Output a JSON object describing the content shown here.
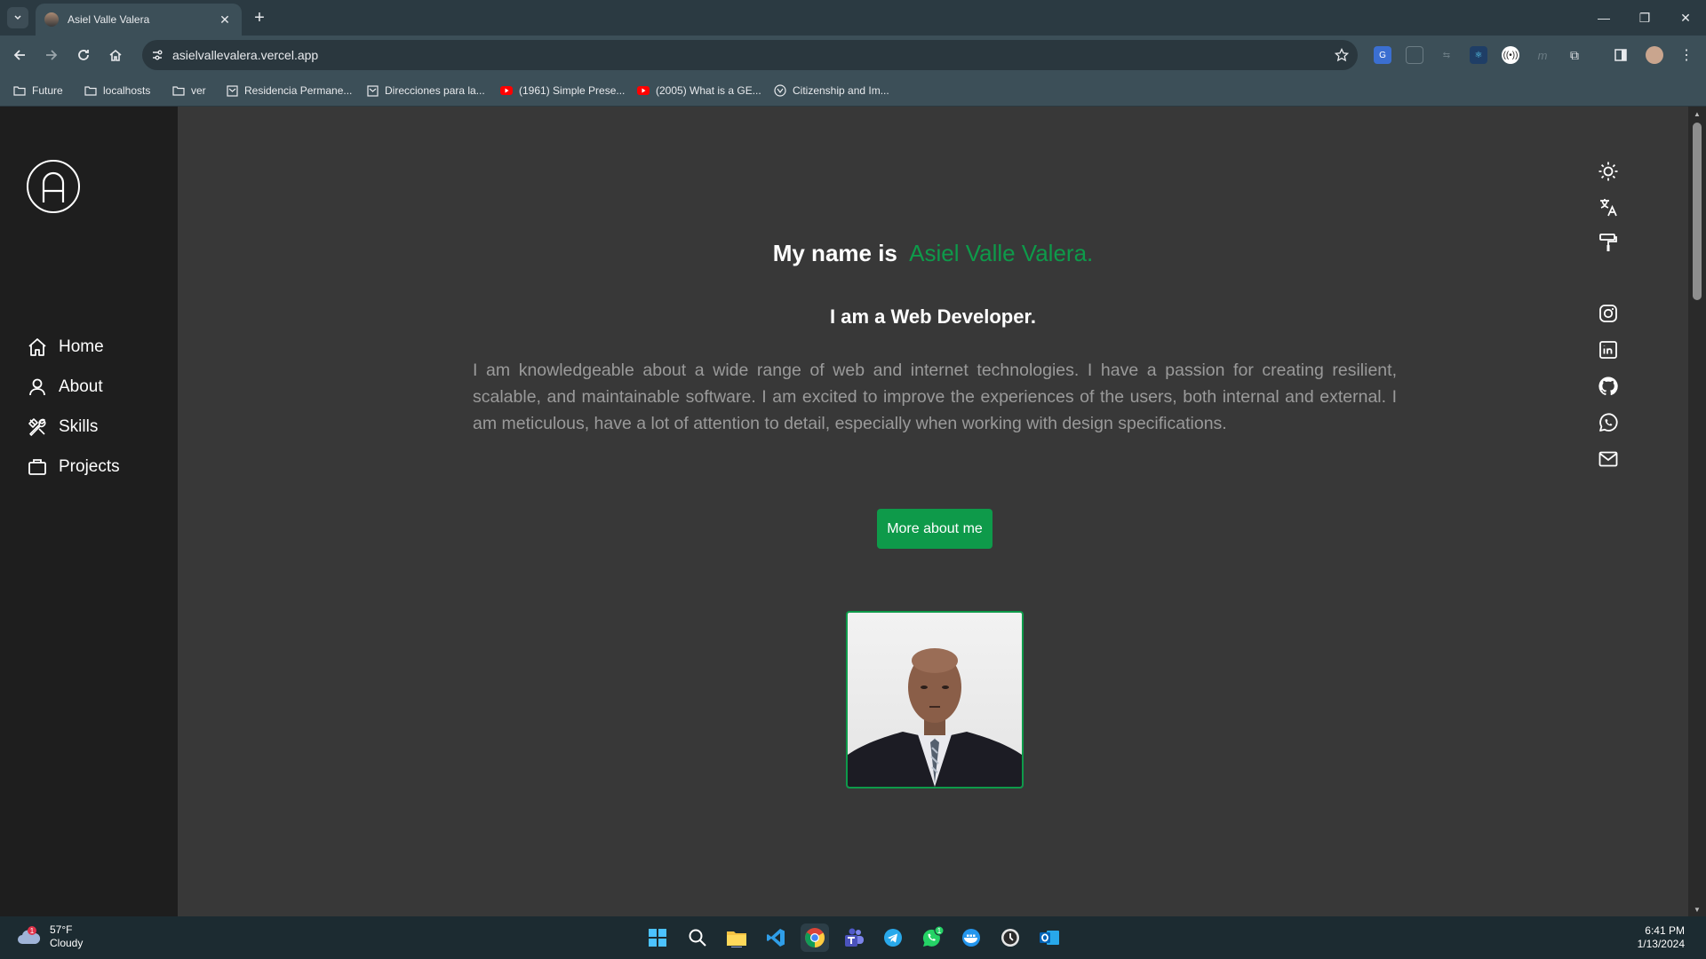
{
  "browser": {
    "tab_title": "Asiel Valle Valera",
    "url": "asielvallevalera.vercel.app",
    "bookmarks": [
      "Future",
      "localhosts",
      "ver",
      "Residencia Permane...",
      "Direcciones para la...",
      "(1961) Simple Prese...",
      "(2005) What is a GE...",
      "Citizenship and Im..."
    ]
  },
  "sidebar": {
    "logo_letter": "A",
    "nav": [
      "Home",
      "About",
      "Skills",
      "Projects"
    ]
  },
  "hero": {
    "intro": "My name is",
    "name": "Asiel Valle Valera.",
    "role": "I am a Web Developer.",
    "bio": "I am knowledgeable about a wide range of web and internet technologies. I have a passion for creating resilient, scalable, and maintainable software. I am excited to improve the experiences of the users, both internal and external. I am meticulous, have a lot of attention to detail, especially when working with design specifications.",
    "cta": "More about me"
  },
  "taskbar": {
    "weather_temp": "57°F",
    "weather_desc": "Cloudy",
    "weather_badge": "1",
    "whatsapp_badge": "1",
    "time": "6:41 PM",
    "date": "1/13/2024"
  },
  "colors": {
    "accent": "#0e9a4a",
    "page_bg": "#383838",
    "sidebar_bg": "#1e1e1e",
    "chrome_bg": "#3c4f58"
  }
}
